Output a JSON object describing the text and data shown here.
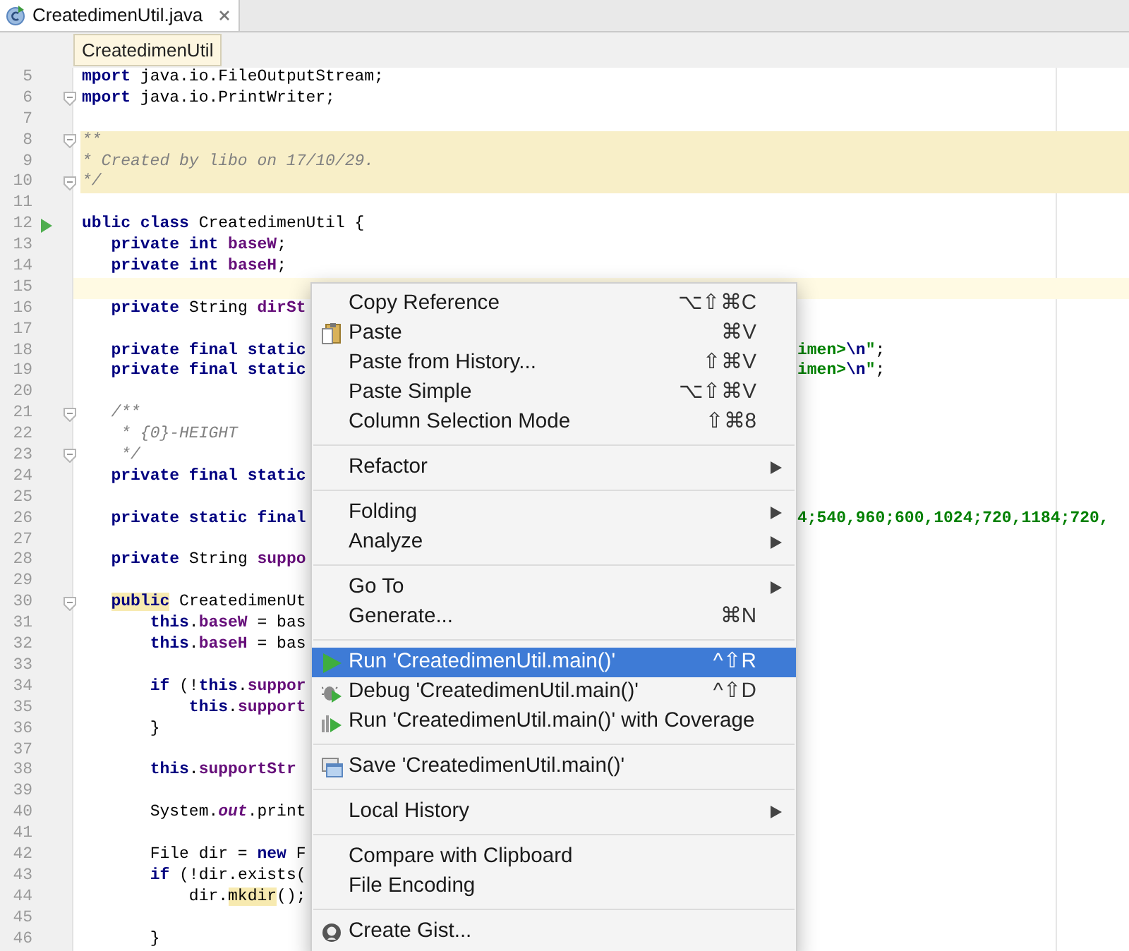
{
  "tab": {
    "title": "CreatedimenUtil.java",
    "selected": true
  },
  "breadcrumb": "CreatedimenUtil",
  "lines": [
    {
      "number": "5",
      "tokens": [
        {
          "kind": "keyword",
          "text": "mport"
        },
        {
          "kind": "plain",
          "text": " java.io.FileOutputStream;"
        }
      ]
    },
    {
      "number": "6",
      "fold_marker": true,
      "tokens": [
        {
          "kind": "keyword",
          "text": "mport"
        },
        {
          "kind": "plain",
          "text": " java.io.PrintWriter;"
        }
      ]
    },
    {
      "number": "7"
    },
    {
      "number": "8",
      "fold_marker": true,
      "doc_comment": true,
      "tokens": [
        {
          "kind": "comment",
          "text": "**"
        }
      ]
    },
    {
      "number": "9",
      "doc_comment": true,
      "tokens": [
        {
          "kind": "comment",
          "text": "* Created by libo on 17/10/29."
        }
      ]
    },
    {
      "number": "10",
      "fold_marker": true,
      "doc_comment": true,
      "tokens": [
        {
          "kind": "comment",
          "text": "*/"
        }
      ]
    },
    {
      "number": "11"
    },
    {
      "number": "12",
      "run_marker": true,
      "tokens": [
        {
          "kind": "keyword",
          "text": "ublic class"
        },
        {
          "kind": "plain",
          "text": " CreatedimenUtil {"
        }
      ]
    },
    {
      "number": "13",
      "tokens": [
        {
          "kind": "keyword",
          "text": "   private int "
        },
        {
          "kind": "field",
          "text": "baseW"
        },
        {
          "kind": "plain",
          "text": ";"
        }
      ]
    },
    {
      "number": "14",
      "tokens": [
        {
          "kind": "keyword",
          "text": "   private int "
        },
        {
          "kind": "field",
          "text": "baseH"
        },
        {
          "kind": "plain",
          "text": ";"
        }
      ]
    },
    {
      "number": "15",
      "current_line": true
    },
    {
      "number": "16",
      "tokens": [
        {
          "kind": "keyword",
          "text": "   private"
        },
        {
          "kind": "plain",
          "text": " String "
        },
        {
          "kind": "field",
          "text": "dirSt"
        }
      ]
    },
    {
      "number": "17"
    },
    {
      "number": "18",
      "tokens": [
        {
          "kind": "keyword",
          "text": "   private final static"
        }
      ],
      "right": [
        {
          "kind": "string",
          "text": "imen>"
        },
        {
          "kind": "escape",
          "text": "\\n"
        },
        {
          "kind": "string",
          "text": "\""
        },
        {
          "kind": "plain",
          "text": ";"
        }
      ]
    },
    {
      "number": "19",
      "tokens": [
        {
          "kind": "keyword",
          "text": "   private final static"
        }
      ],
      "right": [
        {
          "kind": "string",
          "text": "imen>"
        },
        {
          "kind": "escape",
          "text": "\\n"
        },
        {
          "kind": "string",
          "text": "\""
        },
        {
          "kind": "plain",
          "text": ";"
        }
      ]
    },
    {
      "number": "20"
    },
    {
      "number": "21",
      "fold_marker": true,
      "tokens": [
        {
          "kind": "comment",
          "text": "   /**"
        }
      ]
    },
    {
      "number": "22",
      "tokens": [
        {
          "kind": "comment",
          "text": "    * {0}-HEIGHT"
        }
      ]
    },
    {
      "number": "23",
      "fold_marker": true,
      "tokens": [
        {
          "kind": "comment",
          "text": "    */"
        }
      ]
    },
    {
      "number": "24",
      "tokens": [
        {
          "kind": "keyword",
          "text": "   private final static"
        }
      ]
    },
    {
      "number": "25"
    },
    {
      "number": "26",
      "tokens": [
        {
          "kind": "keyword",
          "text": "   private static final"
        }
      ],
      "right": [
        {
          "kind": "string",
          "text": "4;540,960;600,1024;720,1184;720,"
        }
      ]
    },
    {
      "number": "27"
    },
    {
      "number": "28",
      "tokens": [
        {
          "kind": "keyword",
          "text": "   private"
        },
        {
          "kind": "plain",
          "text": " String "
        },
        {
          "kind": "field",
          "text": "suppo"
        }
      ]
    },
    {
      "number": "29"
    },
    {
      "number": "30",
      "fold_marker": true,
      "tokens": [
        {
          "kind": "keyword_marked",
          "text": "   public"
        },
        {
          "kind": "plain",
          "text": " CreatedimenUt"
        }
      ]
    },
    {
      "number": "31",
      "tokens": [
        {
          "kind": "keyword",
          "text": "       this"
        },
        {
          "kind": "plain",
          "text": "."
        },
        {
          "kind": "field",
          "text": "baseW"
        },
        {
          "kind": "plain",
          "text": " = bas"
        }
      ]
    },
    {
      "number": "32",
      "tokens": [
        {
          "kind": "keyword",
          "text": "       this"
        },
        {
          "kind": "plain",
          "text": "."
        },
        {
          "kind": "field",
          "text": "baseH"
        },
        {
          "kind": "plain",
          "text": " = bas"
        }
      ]
    },
    {
      "number": "33"
    },
    {
      "number": "34",
      "tokens": [
        {
          "kind": "keyword",
          "text": "       if"
        },
        {
          "kind": "plain",
          "text": " (!"
        },
        {
          "kind": "keyword",
          "text": "this"
        },
        {
          "kind": "plain",
          "text": "."
        },
        {
          "kind": "field",
          "text": "suppor"
        }
      ]
    },
    {
      "number": "35",
      "tokens": [
        {
          "kind": "keyword",
          "text": "           this"
        },
        {
          "kind": "plain",
          "text": "."
        },
        {
          "kind": "field",
          "text": "support"
        }
      ]
    },
    {
      "number": "36",
      "tokens": [
        {
          "kind": "plain",
          "text": "       }"
        }
      ]
    },
    {
      "number": "37"
    },
    {
      "number": "38",
      "tokens": [
        {
          "kind": "keyword",
          "text": "       this"
        },
        {
          "kind": "plain",
          "text": "."
        },
        {
          "kind": "field",
          "text": "supportStr"
        }
      ]
    },
    {
      "number": "39"
    },
    {
      "number": "40",
      "tokens": [
        {
          "kind": "plain",
          "text": "       System."
        },
        {
          "kind": "static",
          "text": "out"
        },
        {
          "kind": "plain",
          "text": ".print"
        }
      ]
    },
    {
      "number": "41"
    },
    {
      "number": "42",
      "tokens": [
        {
          "kind": "plain",
          "text": "       File dir = "
        },
        {
          "kind": "keyword",
          "text": "new"
        },
        {
          "kind": "plain",
          "text": " F"
        }
      ]
    },
    {
      "number": "43",
      "tokens": [
        {
          "kind": "keyword",
          "text": "       if"
        },
        {
          "kind": "plain",
          "text": " (!dir.exists("
        }
      ]
    },
    {
      "number": "44",
      "tokens": [
        {
          "kind": "plain",
          "text": "           dir."
        },
        {
          "kind": "marked",
          "text": "mkdir"
        },
        {
          "kind": "plain",
          "text": "();"
        }
      ]
    },
    {
      "number": "45"
    },
    {
      "number": "46",
      "tokens": [
        {
          "kind": "plain",
          "text": "       }"
        }
      ]
    }
  ],
  "menu": {
    "groups": [
      [
        {
          "label": "Copy Reference",
          "shortcut": "⌥⇧⌘C",
          "submenu": false,
          "selected": false
        },
        {
          "label": "Paste",
          "shortcut": "⌘V",
          "submenu": false,
          "selected": false
        },
        {
          "label": "Paste from History...",
          "shortcut": "⇧⌘V",
          "submenu": false,
          "selected": false
        },
        {
          "label": "Paste Simple",
          "shortcut": "⌥⇧⌘V",
          "submenu": false,
          "selected": false
        },
        {
          "label": "Column Selection Mode",
          "shortcut": "⇧⌘8",
          "submenu": false,
          "selected": false
        }
      ],
      [
        {
          "label": "Refactor",
          "submenu": true,
          "selected": false
        }
      ],
      [
        {
          "label": "Folding",
          "submenu": true,
          "selected": false
        },
        {
          "label": "Analyze",
          "submenu": true,
          "selected": false
        }
      ],
      [
        {
          "label": "Go To",
          "submenu": true,
          "selected": false
        },
        {
          "label": "Generate...",
          "shortcut": "⌘N",
          "submenu": false,
          "selected": false
        }
      ],
      [
        {
          "label": "Run 'CreatedimenUtil.main()'",
          "shortcut": "^⇧R",
          "submenu": false,
          "selected": true
        },
        {
          "label": "Debug 'CreatedimenUtil.main()'",
          "shortcut": "^⇧D",
          "submenu": false,
          "selected": false
        },
        {
          "label": "Run 'CreatedimenUtil.main()' with Coverage",
          "submenu": false,
          "selected": false
        }
      ],
      [
        {
          "label": "Save 'CreatedimenUtil.main()'",
          "submenu": false,
          "selected": false
        }
      ],
      [
        {
          "label": "Local History",
          "submenu": true,
          "selected": false
        }
      ],
      [
        {
          "label": "Compare with Clipboard",
          "submenu": false,
          "selected": false
        },
        {
          "label": "File Encoding",
          "submenu": false,
          "selected": false
        }
      ],
      [
        {
          "label": "Create Gist...",
          "submenu": false,
          "selected": false
        }
      ]
    ]
  }
}
